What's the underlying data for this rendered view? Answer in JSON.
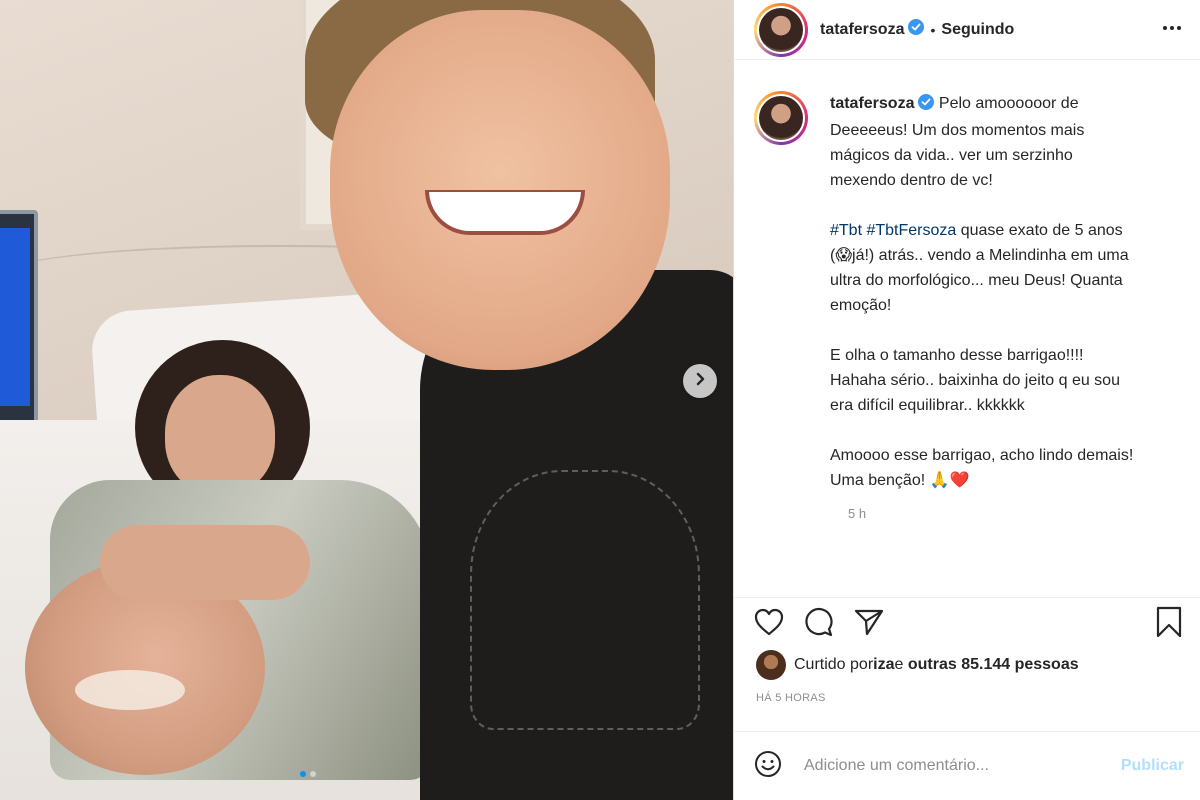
{
  "post": {
    "username": "tatafersoza",
    "separator": "•",
    "follow_state": "Seguindo",
    "more_icon": "more-horizontal-icon",
    "carousel": {
      "total": 2,
      "active": 0
    }
  },
  "caption": {
    "username": "tatafersoza",
    "p1": " Pelo amoooooor de Deeeeeus! Um dos momentos mais mágicos da vida.. ver um serzinho mexendo dentro de vc!",
    "hashtag1": "#Tbt",
    "hashtag2": "#TbtFersoza",
    "p2_rest": " quase exato de 5 anos (😱já!) atrás.. vendo a Melindinha em uma ultra do morfológico... meu Deus! Quanta emoção!",
    "p3": "E olha o tamanho desse barrigao!!!! Hahaha sério.. baixinha do jeito q eu sou era difícil equilibrar.. kkkkkk",
    "p4": "Amoooo esse barrigao, acho lindo demais! Uma benção! 🙏❤️",
    "time": "5 h"
  },
  "likes": {
    "prefix": "Curtido por ",
    "user": "iza",
    "middle": " e ",
    "others": "outras 85.144 pessoas"
  },
  "posted_ago": "HÁ 5 HORAS",
  "comment": {
    "placeholder": "Adicione um comentário...",
    "publish_label": "Publicar"
  },
  "colors": {
    "accent": "#0095f6",
    "verified": "#3897f0",
    "publish_disabled": "#b2dffc",
    "hashtag": "#00376b",
    "muted": "#8e8e8e"
  }
}
